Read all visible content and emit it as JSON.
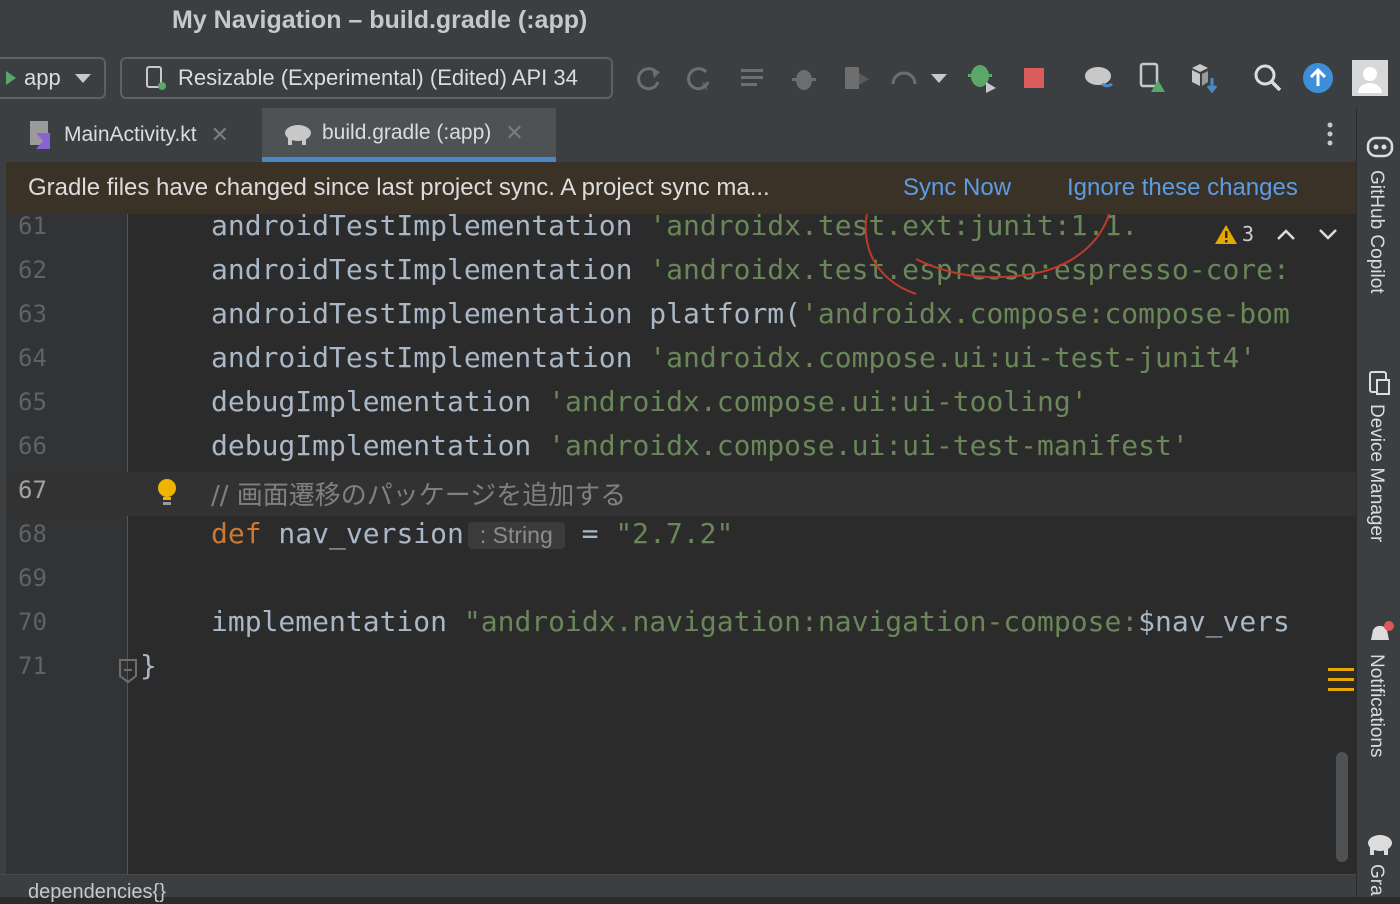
{
  "window": {
    "title": "My Navigation – build.gradle (:app)"
  },
  "toolbar": {
    "run_config": "app",
    "device": "Resizable (Experimental) (Edited) API 34",
    "icons": [
      "apply-changes-icon",
      "apply-code-changes-icon",
      "profile-icon",
      "debug-icon",
      "coverage-icon",
      "attach-icon",
      "more-run-icon",
      "debug-app-icon",
      "stop-icon",
      "sync-gradle-icon",
      "device-manager-icon",
      "sdk-manager-icon",
      "search-icon",
      "update-icon",
      "avatar"
    ]
  },
  "tabs": [
    {
      "label": "MainActivity.kt",
      "icon": "kotlin-file-icon",
      "active": false
    },
    {
      "label": "build.gradle (:app)",
      "icon": "gradle-elephant-icon",
      "active": true
    }
  ],
  "banner": {
    "message": "Gradle files have changed since last project sync. A project sync ma...",
    "sync_now": "Sync Now",
    "ignore": "Ignore these changes"
  },
  "editor": {
    "warning_count": "3",
    "lines": [
      {
        "num": "61",
        "a": "androidTestImplementation ",
        "s": "'androidx.test.ext:junit:1.1.",
        "b": ""
      },
      {
        "num": "62",
        "a": "androidTestImplementation ",
        "s": "'androidx.test.espresso:espresso-core:",
        "b": ""
      },
      {
        "num": "63",
        "a": "androidTestImplementation platform(",
        "s": "'androidx.compose:compose-bom",
        "b": ""
      },
      {
        "num": "64",
        "a": "androidTestImplementation ",
        "s": "'androidx.compose.ui:ui-test-junit4'",
        "b": ""
      },
      {
        "num": "65",
        "a": "debugImplementation ",
        "s": "'androidx.compose.ui:ui-tooling'",
        "b": ""
      },
      {
        "num": "66",
        "a": "debugImplementation ",
        "s": "'androidx.compose.ui:ui-test-manifest'",
        "b": ""
      },
      {
        "num": "67",
        "comment": "// 画面遷移のパッケージを追加する"
      },
      {
        "num": "68",
        "kw": "def",
        "var": " nav_version",
        "hint": ": String",
        "eq": " = ",
        "s": "\"2.7.2\""
      },
      {
        "num": "69"
      },
      {
        "num": "70",
        "a": "implementation ",
        "s": "\"androidx.navigation:navigation-compose:",
        "b": "$nav_vers"
      },
      {
        "num": "71",
        "a": "}"
      }
    ]
  },
  "right_panel": [
    "GitHub Copilot",
    "Device Manager",
    "Notifications",
    "Gra"
  ],
  "status": {
    "breadcrumb": "dependencies{}"
  },
  "colors": {
    "accent": "#4a88c7",
    "link": "#5c9ce6",
    "annotation": "#c0392b"
  }
}
